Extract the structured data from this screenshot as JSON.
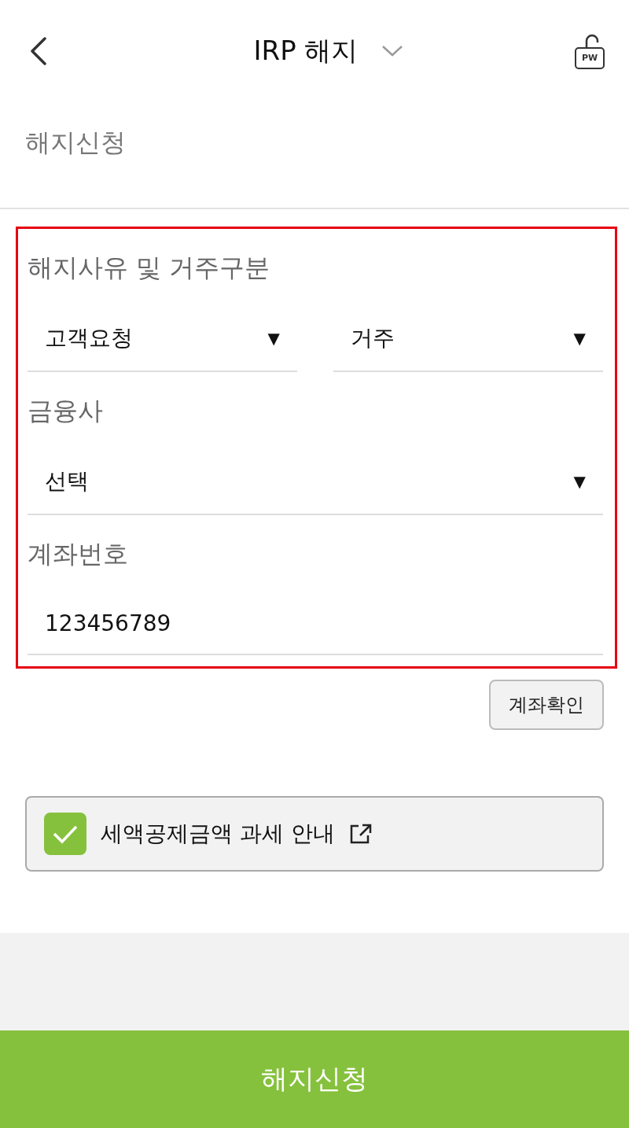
{
  "header": {
    "title": "IRP 해지",
    "lock_badge": "PW"
  },
  "section_title": "해지신청",
  "form": {
    "highlighted": true,
    "reason_label": "해지사유 및 거주구분",
    "selects": [
      {
        "value": "고객요청",
        "marker": "▼"
      },
      {
        "value": "거주",
        "marker": "▼"
      }
    ],
    "institution_label": "금융사",
    "institution": {
      "value": "선택",
      "marker": "▼"
    },
    "account_label": "계좌번호",
    "account": {
      "value": "123456789"
    }
  },
  "verify_button": "계좌확인",
  "notice": {
    "checked": true,
    "label": "세액공제금액 과세 안내"
  },
  "submit_button": "해지신청"
}
